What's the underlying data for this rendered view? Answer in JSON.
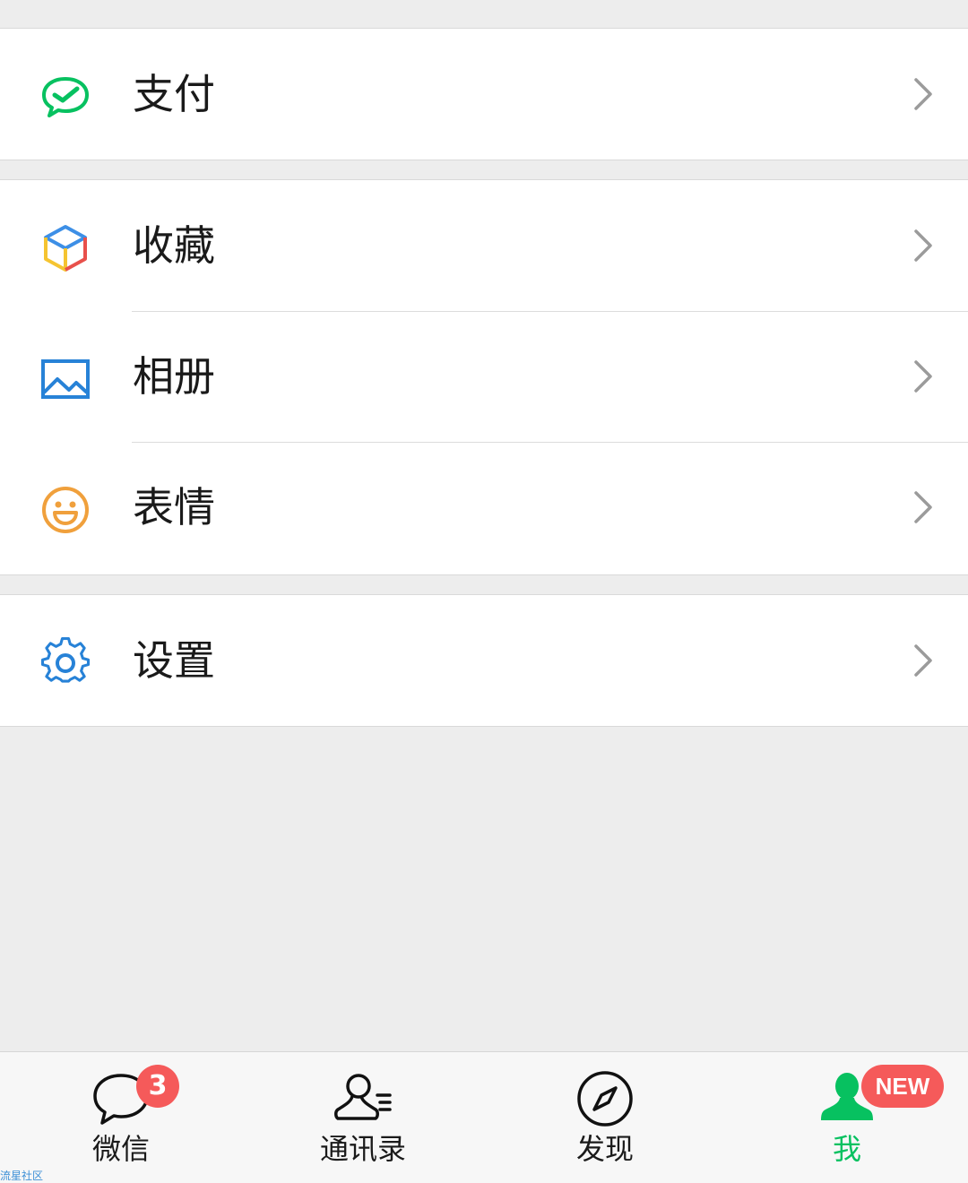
{
  "sections": [
    {
      "items": [
        {
          "label": "支付",
          "icon": "wallet-check-icon",
          "color": "#07c160"
        }
      ]
    },
    {
      "items": [
        {
          "label": "收藏",
          "icon": "cube-icon",
          "color": "#3d8fe6"
        },
        {
          "label": "相册",
          "icon": "picture-icon",
          "color": "#2782d7"
        },
        {
          "label": "表情",
          "icon": "smiley-icon",
          "color": "#f0a03c"
        }
      ]
    },
    {
      "items": [
        {
          "label": "设置",
          "icon": "gear-icon",
          "color": "#2782d7"
        }
      ]
    }
  ],
  "tabbar": {
    "tabs": [
      {
        "label": "微信",
        "icon": "chat-bubble-icon",
        "badge": "3",
        "active": false
      },
      {
        "label": "通讯录",
        "icon": "contacts-icon",
        "active": false
      },
      {
        "label": "发现",
        "icon": "compass-icon",
        "active": false
      },
      {
        "label": "我",
        "icon": "person-icon",
        "badge": "NEW",
        "active": true
      }
    ],
    "active_color": "#07c160",
    "badge_color": "#f55a5a"
  },
  "watermark": "流星社区"
}
